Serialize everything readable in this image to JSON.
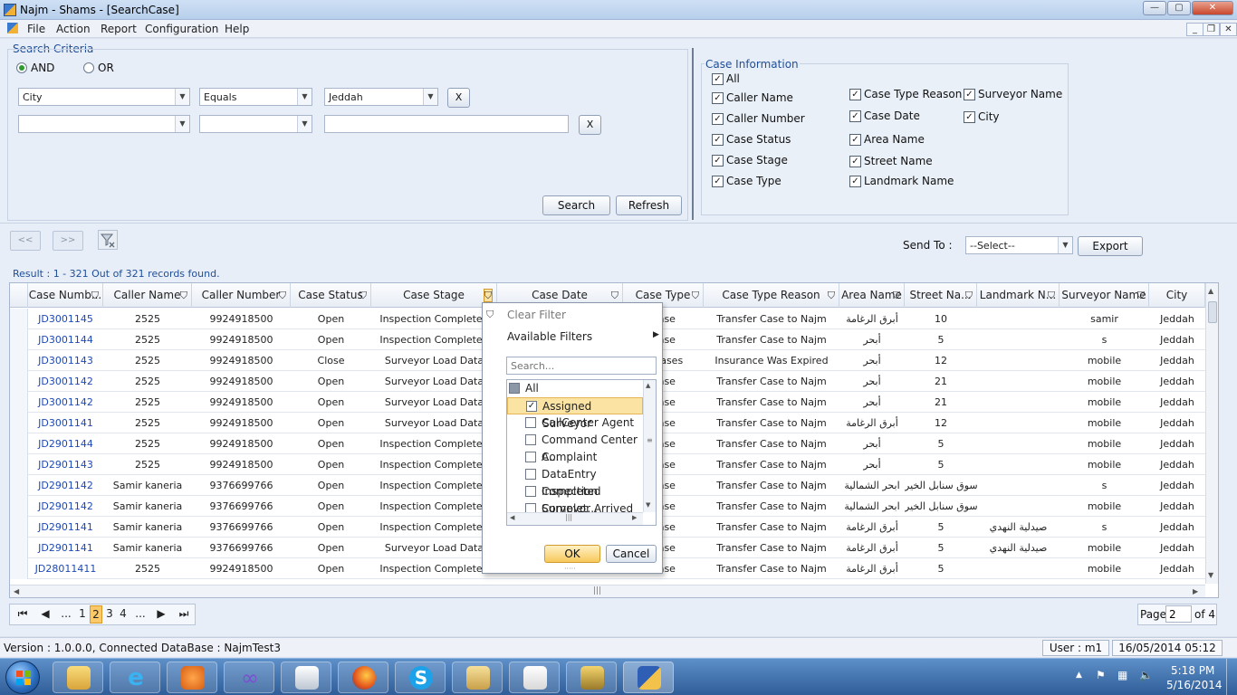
{
  "window": {
    "title": "Najm - Shams - [SearchCase]"
  },
  "menu": [
    "File",
    "Action",
    "Report",
    "Configuration",
    "Help"
  ],
  "search_criteria": {
    "legend": "Search Criteria",
    "and_label": "AND",
    "or_label": "OR",
    "selected": "AND",
    "row1": {
      "field": "City",
      "operator": "Equals",
      "value": "Jeddah"
    },
    "row2": {
      "field": "",
      "operator": "",
      "value": ""
    },
    "remove_label": "X",
    "search_button": "Search",
    "refresh_button": "Refresh"
  },
  "case_information": {
    "legend": "Case Information",
    "items": [
      {
        "label": "All",
        "checked": true
      },
      {
        "label": "Caller Name",
        "checked": true
      },
      {
        "label": "Caller Number",
        "checked": true
      },
      {
        "label": "Case Status",
        "checked": true
      },
      {
        "label": "Case Stage",
        "checked": true
      },
      {
        "label": "Case Type",
        "checked": true
      },
      {
        "label": "Case Type Reason",
        "checked": true
      },
      {
        "label": "Case Date",
        "checked": true
      },
      {
        "label": "Area Name",
        "checked": true
      },
      {
        "label": "Street Name",
        "checked": true
      },
      {
        "label": "Landmark Name",
        "checked": true
      },
      {
        "label": "Surveyor Name",
        "checked": true
      },
      {
        "label": "City",
        "checked": true
      }
    ]
  },
  "toolbar": {
    "prev_label": "<<",
    "next_label": ">>",
    "send_to_label": "Send To :",
    "send_to_value": "--Select--",
    "export_button": "Export"
  },
  "result_text": "Result : 1 - 321 Out of 321 records found.",
  "grid": {
    "columns": [
      "Case Numb...",
      "Caller Name",
      "Caller Number",
      "Case Status",
      "Case Stage",
      "Case Date",
      "Case Type",
      "Case Type Reason",
      "Area Name",
      "Street Na...",
      "Landmark N...",
      "Surveyor Name",
      "City"
    ],
    "rows": [
      [
        "JD3001145",
        "2525",
        "9924918500",
        "Open",
        "Inspection Completed",
        "",
        "Case",
        "Transfer Case to Najm",
        "أبرق الرغامة",
        "10",
        "",
        "samir",
        "Jeddah"
      ],
      [
        "JD3001144",
        "2525",
        "9924918500",
        "Open",
        "Inspection Completed",
        "",
        "Case",
        "Transfer Case to Najm",
        "أبحر",
        "5",
        "",
        "s",
        "Jeddah"
      ],
      [
        "JD3001143",
        "2525",
        "9924918500",
        "Close",
        "Surveyor Load Data",
        "",
        "mCases",
        "Insurance Was Expired",
        "أبحر",
        "12",
        "",
        "mobile",
        "Jeddah"
      ],
      [
        "JD3001142",
        "2525",
        "9924918500",
        "Open",
        "Surveyor Load Data",
        "",
        "Case",
        "Transfer Case to Najm",
        "أبحر",
        "21",
        "",
        "mobile",
        "Jeddah"
      ],
      [
        "JD3001142",
        "2525",
        "9924918500",
        "Open",
        "Surveyor Load Data",
        "",
        "Case",
        "Transfer Case to Najm",
        "أبحر",
        "21",
        "",
        "mobile",
        "Jeddah"
      ],
      [
        "JD3001141",
        "2525",
        "9924918500",
        "Open",
        "Surveyor Load Data",
        "",
        "Case",
        "Transfer Case to Najm",
        "أبرق الرغامة",
        "12",
        "",
        "mobile",
        "Jeddah"
      ],
      [
        "JD2901144",
        "2525",
        "9924918500",
        "Open",
        "Inspection Completed",
        "",
        "Case",
        "Transfer Case to Najm",
        "أبحر",
        "5",
        "",
        "mobile",
        "Jeddah"
      ],
      [
        "JD2901143",
        "2525",
        "9924918500",
        "Open",
        "Inspection Completed",
        "",
        "Case",
        "Transfer Case to Najm",
        "أبحر",
        "5",
        "",
        "mobile",
        "Jeddah"
      ],
      [
        "JD2901142",
        "Samir kaneria",
        "9376699766",
        "Open",
        "Inspection Completed",
        "",
        "Case",
        "Transfer Case to Najm",
        "ابحر الشمالية",
        "سوق سنابل الخير",
        "",
        "s",
        "Jeddah"
      ],
      [
        "JD2901142",
        "Samir kaneria",
        "9376699766",
        "Open",
        "Inspection Completed",
        "",
        "Case",
        "Transfer Case to Najm",
        "ابحر الشمالية",
        "سوق سنابل الخير",
        "",
        "mobile",
        "Jeddah"
      ],
      [
        "JD2901141",
        "Samir kaneria",
        "9376699766",
        "Open",
        "Inspection Completed",
        "",
        "Case",
        "Transfer Case to Najm",
        "أبرق الرغامة",
        "5",
        "صيدلية النهدي",
        "s",
        "Jeddah"
      ],
      [
        "JD2901141",
        "Samir kaneria",
        "9376699766",
        "Open",
        "Surveyor Load Data",
        "",
        "Case",
        "Transfer Case to Najm",
        "أبرق الرغامة",
        "5",
        "صيدلية النهدي",
        "mobile",
        "Jeddah"
      ],
      [
        "JD28011411",
        "2525",
        "9924918500",
        "Open",
        "Inspection Completed",
        "",
        "Case",
        "Transfer Case to Najm",
        "أبرق الرغامة",
        "5",
        "",
        "mobile",
        "Jeddah"
      ]
    ]
  },
  "filter_popup": {
    "clear_filter": "Clear Filter",
    "available_filters": "Available Filters",
    "search_placeholder": "Search...",
    "items": [
      {
        "label": "All",
        "checked": false,
        "selected": false
      },
      {
        "label": "Assigned Surveyor",
        "checked": true,
        "selected": true
      },
      {
        "label": "CallCenter Agent",
        "checked": false,
        "selected": false
      },
      {
        "label": "Command Center A...",
        "checked": false,
        "selected": false
      },
      {
        "label": "Complaint",
        "checked": false,
        "selected": false
      },
      {
        "label": "DataEntry Completed",
        "checked": false,
        "selected": false
      },
      {
        "label": "Inspection Complet...",
        "checked": false,
        "selected": false
      },
      {
        "label": "Surveyor Arrived",
        "checked": false,
        "selected": false
      }
    ],
    "ok_button": "OK",
    "cancel_button": "Cancel"
  },
  "pager": {
    "ellipsis": "...",
    "pages": [
      "1",
      "2",
      "3",
      "4"
    ],
    "current_page": "2",
    "page_label": "Page",
    "page_value": "2",
    "of_label": "of 4"
  },
  "status": {
    "version": "Version : 1.0.0.0, Connected DataBase : NajmTest3",
    "user": "User : m1",
    "datetime": "16/05/2014 05:12 PM"
  },
  "taskbar": {
    "time": "5:18 PM",
    "date": "5/16/2014"
  }
}
